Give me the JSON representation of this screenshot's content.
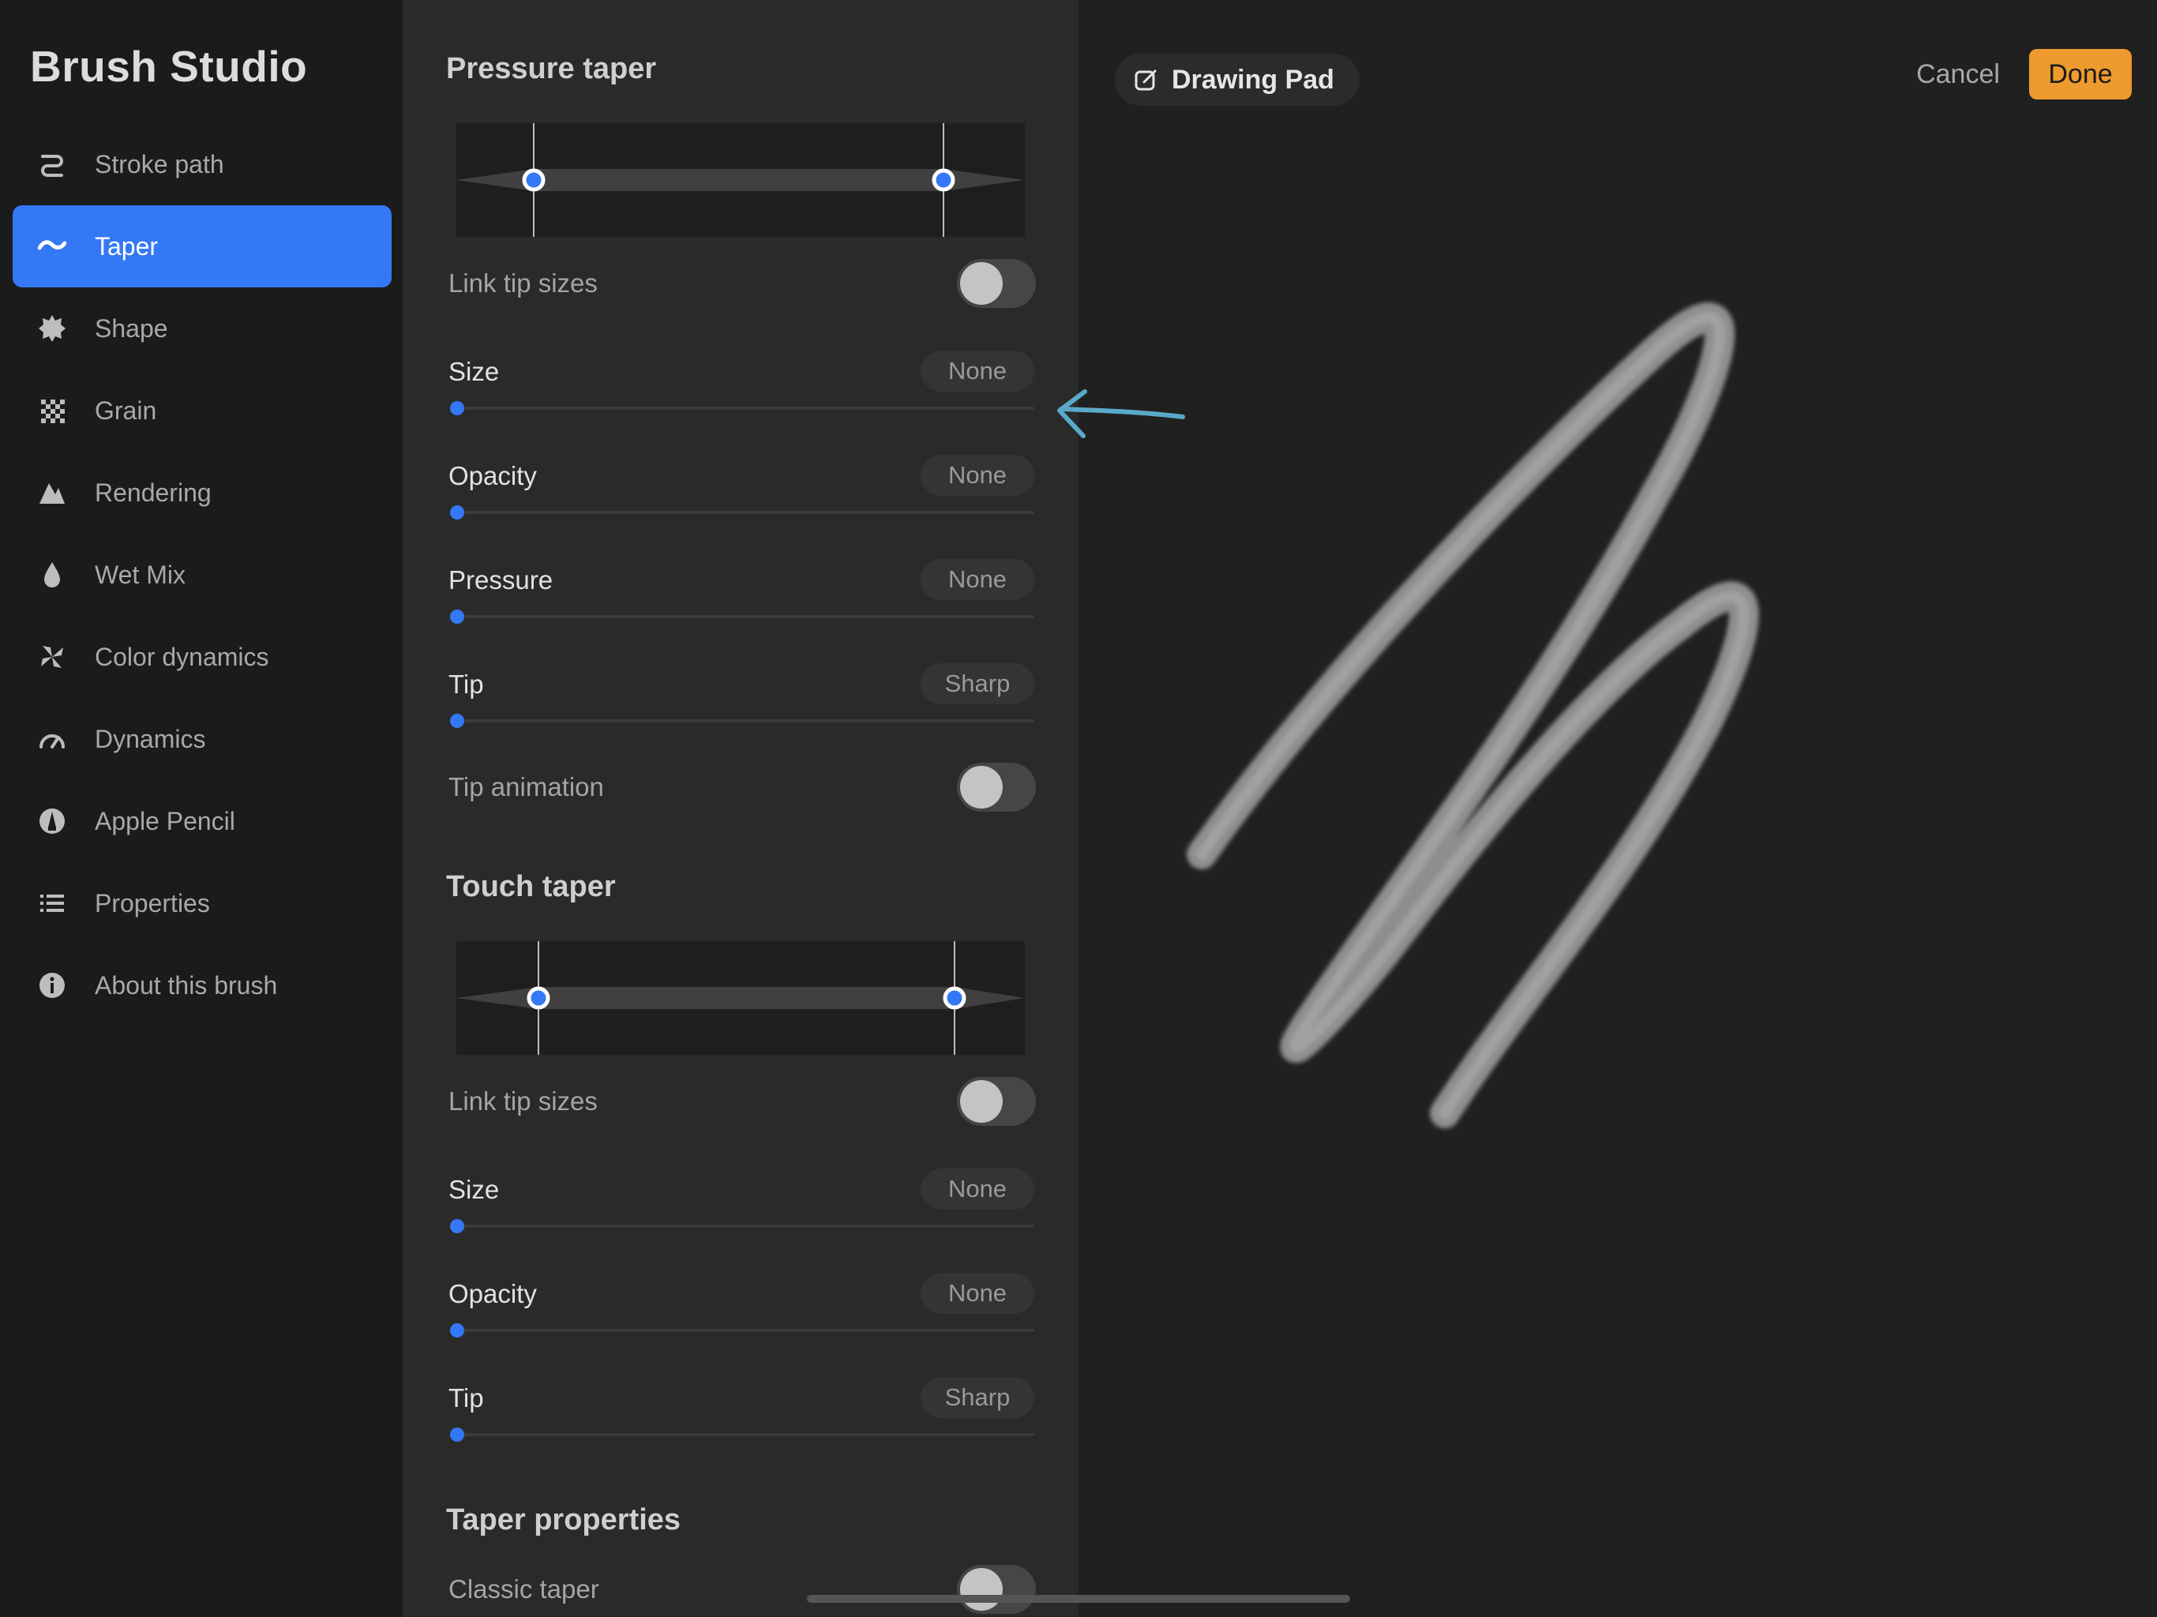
{
  "app": {
    "title": "Brush Studio"
  },
  "sidebar": {
    "items": [
      {
        "label": "Stroke path",
        "icon": "stroke-path-icon",
        "active": false
      },
      {
        "label": "Taper",
        "icon": "taper-icon",
        "active": true
      },
      {
        "label": "Shape",
        "icon": "shape-icon",
        "active": false
      },
      {
        "label": "Grain",
        "icon": "grain-icon",
        "active": false
      },
      {
        "label": "Rendering",
        "icon": "rendering-icon",
        "active": false
      },
      {
        "label": "Wet Mix",
        "icon": "wet-mix-icon",
        "active": false
      },
      {
        "label": "Color dynamics",
        "icon": "color-dynamics-icon",
        "active": false
      },
      {
        "label": "Dynamics",
        "icon": "dynamics-icon",
        "active": false
      },
      {
        "label": "Apple Pencil",
        "icon": "apple-pencil-icon",
        "active": false
      },
      {
        "label": "Properties",
        "icon": "properties-icon",
        "active": false
      },
      {
        "label": "About this brush",
        "icon": "info-icon",
        "active": false
      }
    ]
  },
  "pressure_taper": {
    "title": "Pressure taper",
    "link_tip_sizes": {
      "label": "Link tip sizes",
      "on": false
    },
    "size": {
      "label": "Size",
      "value": "None",
      "level": 0
    },
    "opacity": {
      "label": "Opacity",
      "value": "None",
      "level": 0
    },
    "pressure": {
      "label": "Pressure",
      "value": "None",
      "level": 0
    },
    "tip": {
      "label": "Tip",
      "value": "Sharp",
      "level": 0
    },
    "tip_animation": {
      "label": "Tip animation",
      "on": false
    }
  },
  "touch_taper": {
    "title": "Touch taper",
    "link_tip_sizes": {
      "label": "Link tip sizes",
      "on": false
    },
    "size": {
      "label": "Size",
      "value": "None",
      "level": 0
    },
    "opacity": {
      "label": "Opacity",
      "value": "None",
      "level": 0
    },
    "tip": {
      "label": "Tip",
      "value": "Sharp",
      "level": 0
    }
  },
  "taper_properties": {
    "title": "Taper properties",
    "classic_taper": {
      "label": "Classic taper",
      "on": false
    }
  },
  "drawing_pad": {
    "label": "Drawing Pad",
    "icon": "edit-icon"
  },
  "header": {
    "cancel_label": "Cancel",
    "done_label": "Done"
  },
  "colors": {
    "accent": "#3478f6",
    "done": "#ee9a2e",
    "arrow_annotation": "#5aa9c8"
  }
}
